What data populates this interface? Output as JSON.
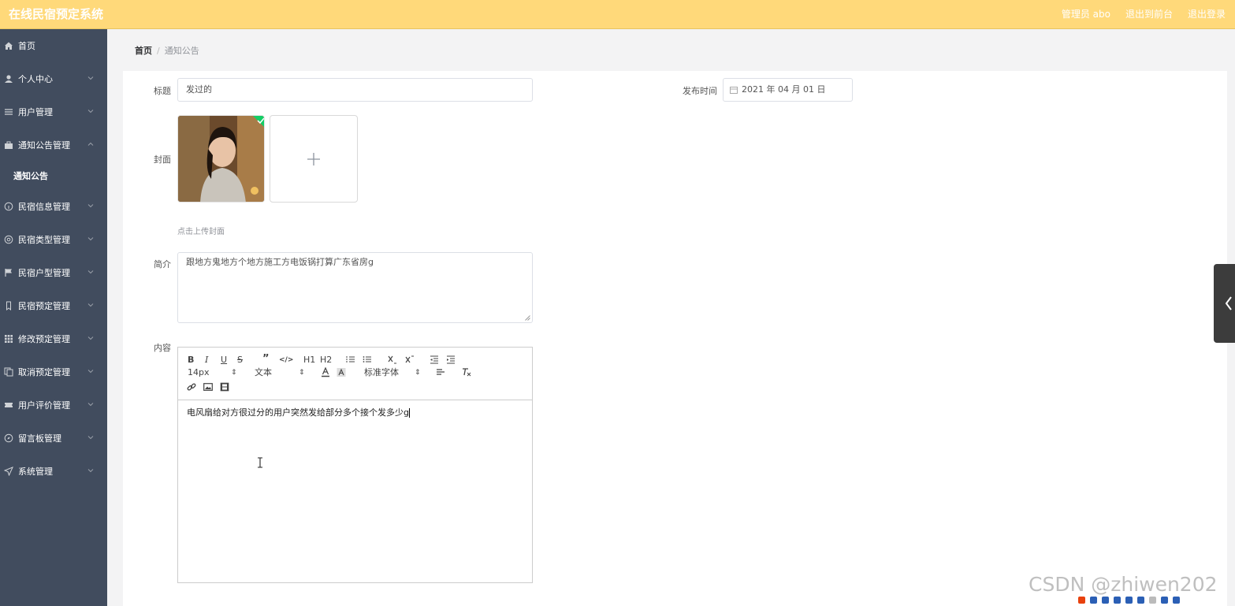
{
  "app": {
    "title": "在线民宿预定系统"
  },
  "top_actions": [
    "管理员 abo",
    "退出到前台",
    "退出登录"
  ],
  "sidebar": {
    "items": [
      {
        "label": "首页",
        "icon": "home-icon"
      },
      {
        "label": "个人中心",
        "icon": "user-icon"
      },
      {
        "label": "用户管理",
        "icon": "list-icon"
      },
      {
        "label": "通知公告管理",
        "icon": "bag-icon",
        "expanded": true
      },
      {
        "label": "民宿信息管理",
        "icon": "info-circle-icon"
      },
      {
        "label": "民宿类型管理",
        "icon": "aperture-icon"
      },
      {
        "label": "民宿户型管理",
        "icon": "flag-icon"
      },
      {
        "label": "民宿预定管理",
        "icon": "bookmark-icon"
      },
      {
        "label": "修改预定管理",
        "icon": "grid-icon"
      },
      {
        "label": "取消预定管理",
        "icon": "copy-icon"
      },
      {
        "label": "用户评价管理",
        "icon": "ticket-icon"
      },
      {
        "label": "留言板管理",
        "icon": "compass-icon"
      },
      {
        "label": "系统管理",
        "icon": "send-icon"
      }
    ],
    "sub_item": "通知公告"
  },
  "breadcrumb": {
    "home": "首页",
    "sep": "/",
    "current": "通知公告"
  },
  "form": {
    "title_label": "标题",
    "title_value": "发过的",
    "date_label": "发布时间",
    "date_value": "2021 年 04 月 01 日",
    "cover_label": "封面",
    "cover_hint": "点击上传封面",
    "intro_label": "简介",
    "intro_value": "跟地方鬼地方个地方施工方电饭锅打算广东省房g",
    "content_label": "内容",
    "content_value": "电风扇给对方很过分的用户突然发给部分多个接个发多少g"
  },
  "editor_toolbar": {
    "font_size": "14px",
    "block_type": "文本",
    "font_family": "标准字体",
    "h1": "H1",
    "h2": "H2"
  },
  "watermark": "CSDN @zhiwen202",
  "colors": {
    "topbar": "#ffd97a",
    "sidebar": "#414c5e",
    "upload_success": "#13ce66"
  }
}
